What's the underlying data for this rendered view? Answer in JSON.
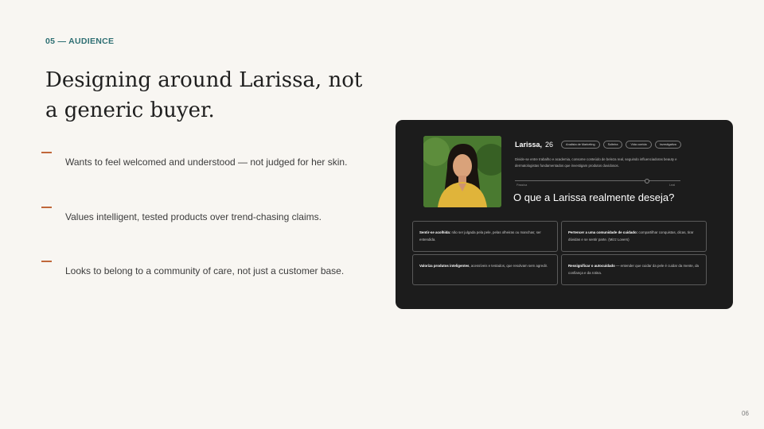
{
  "section_label": "05 — AUDIENCE",
  "title": "Designing around Larissa, not a generic buyer.",
  "bullets": [
    "Wants to feel welcomed and understood — not judged for her skin.",
    "Values intelligent, tested products over trend-chasing claims.",
    "Looks to belong to a community of care, not just a customer base."
  ],
  "persona": {
    "name": "Larissa,",
    "age": "26",
    "tags": [
      "Analista de Marketing",
      "Solteira",
      "Vida corrida",
      "Investigativa"
    ],
    "bio": "Divide-se entre trabalho e academia, consome conteúdo de beleza real, seguindo influenciadoras beauty e dermatologistas fundamentados que investigam produtos duvidosos.",
    "slider": {
      "left_label": "Passiva",
      "right_label": "Leal",
      "value": 0.8
    },
    "question": "O que a Larissa realmente deseja?",
    "desires": [
      {
        "bold": "Sentir-se acolhida:",
        "text": " não ser julgada pela pele, pelas olheiras ou manchas; ser entendida."
      },
      {
        "bold": "Pertencer a uma comunidade de cuidado:",
        "text": " compartilhar conquistas, dicas, tirar dúvidas e se sentir parte. (Mizz Lovers)"
      },
      {
        "bold": "Valoriza produtos inteligentes",
        "text": ", acessíveis e testados, que resolvam sem agredir."
      },
      {
        "bold": "Ressignificar o autocuidado",
        "text": " — entender que cuidar da pele é cuidar da mente, da confiança e da rotina."
      }
    ]
  },
  "page_number": "06",
  "colors": {
    "accent_teal": "#2e6f73",
    "dash_orange": "#c0673a",
    "card_bg": "#1c1c1c",
    "page_bg": "#f8f6f2"
  }
}
